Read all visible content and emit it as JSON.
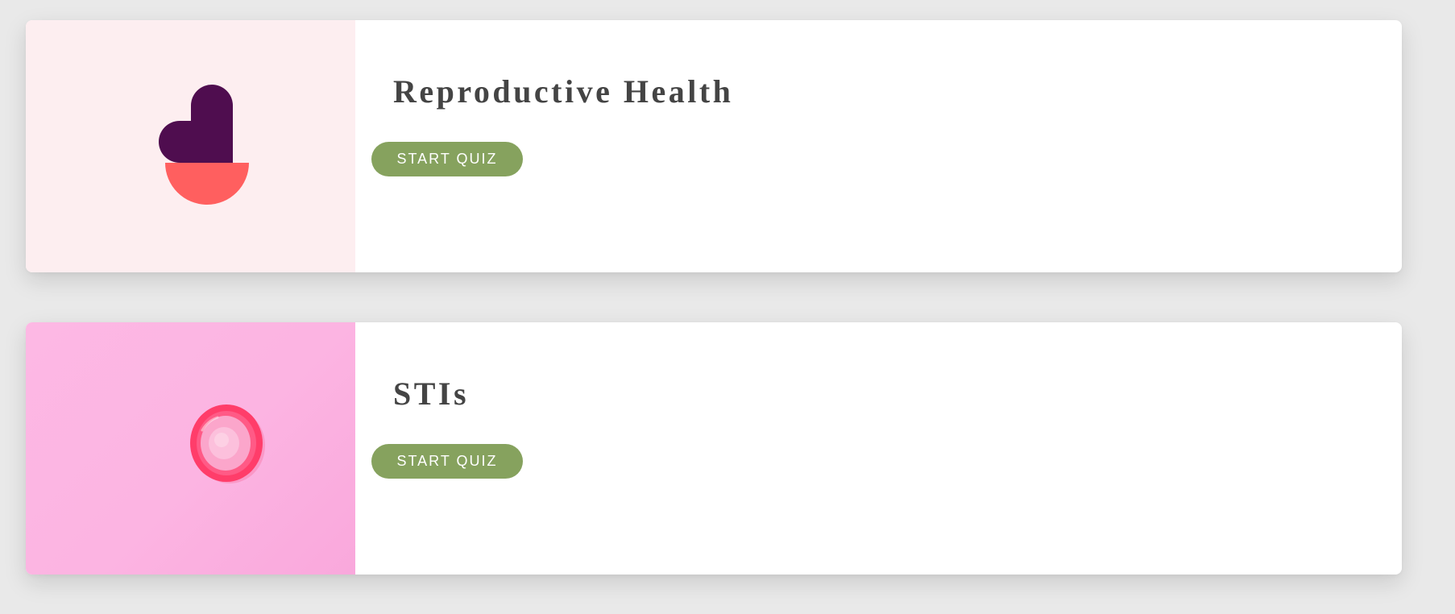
{
  "quizzes": [
    {
      "title": "Reproductive Health",
      "button_label": "START QUIZ",
      "image": "reproductive-health-logo-icon",
      "thumb_color": "#fdeef0",
      "logo_colors": {
        "heart": "#4f0d4f",
        "bowl": "#ff5f5f"
      }
    },
    {
      "title": "STIs",
      "button_label": "START QUIZ",
      "image": "condom-icon",
      "thumb_color": "#fcb4e2",
      "logo_colors": {
        "ring": "#ff3a68"
      }
    }
  ],
  "colors": {
    "page_background": "#e9e9e9",
    "card_background": "#ffffff",
    "title_text": "#444444",
    "button_background": "#86a25e",
    "button_text": "#ffffff"
  }
}
